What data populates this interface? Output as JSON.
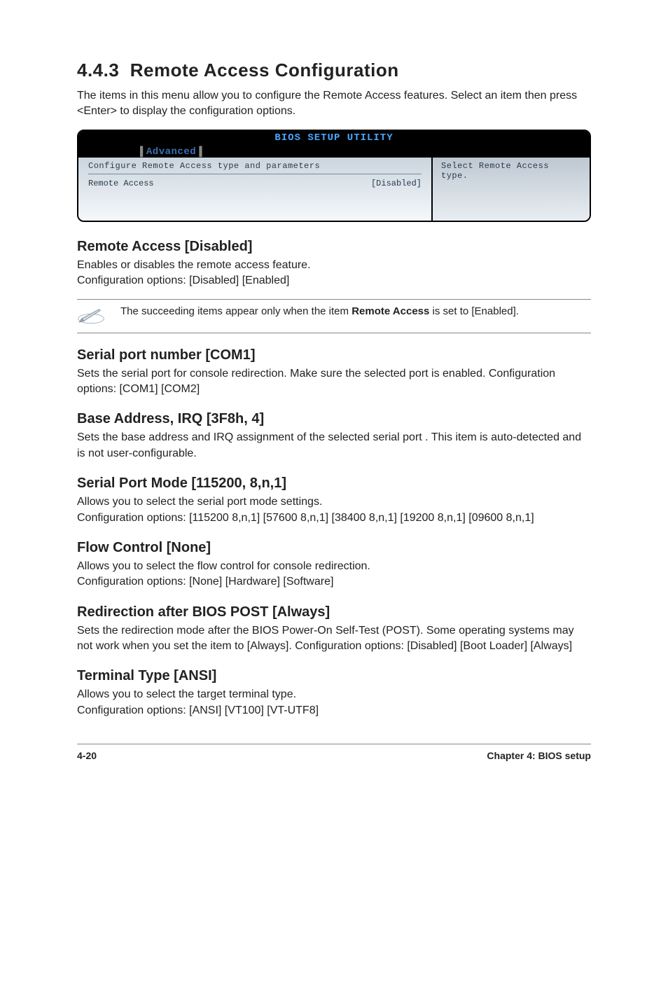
{
  "heading": {
    "number": "4.4.3",
    "title": "Remote Access Configuration"
  },
  "intro": "The items in this menu allow you to configure the Remote Access features. Select an item then press <Enter> to display the configuration options.",
  "bios": {
    "title": "BIOS SETUP UTILITY",
    "tab": "Advanced",
    "panel_title": "Configure Remote Access type and parameters",
    "option_label": "Remote Access",
    "option_value": "[Disabled]",
    "help": "Select Remote Access type."
  },
  "sections": [
    {
      "title": "Remote Access [Disabled]",
      "body": "Enables or disables the remote access feature.\nConfiguration options: [Disabled] [Enabled]"
    }
  ],
  "note": {
    "pre": "The succeeding items appear only when the item ",
    "bold": "Remote Access",
    "post": " is set to [Enabled]."
  },
  "sections2": [
    {
      "title": "Serial port number [COM1]",
      "body": "Sets the serial port for console redirection.  Make sure the selected port is enabled. Configuration options: [COM1] [COM2]"
    },
    {
      "title": "Base Address, IRQ [3F8h, 4]",
      "body": "Sets the base address and IRQ assignment of the selected serial port . This item is auto-detected and is not user-configurable."
    },
    {
      "title": "Serial Port Mode [115200, 8,n,1]",
      "body": "Allows you to select the serial port mode settings.\nConfiguration options: [115200 8,n,1] [57600 8,n,1] [38400 8,n,1] [19200 8,n,1] [09600 8,n,1]"
    },
    {
      "title": "Flow Control [None]",
      "body": "Allows you to select the flow control for console redirection.\nConfiguration options: [None] [Hardware] [Software]"
    },
    {
      "title": "Redirection after BIOS POST [Always]",
      "body": "Sets the redirection mode after the BIOS Power-On Self-Test (POST). Some operating systems may not work when you set the item to [Always]. Configuration options: [Disabled] [Boot Loader] [Always]"
    },
    {
      "title": "Terminal Type [ANSI]",
      "body": "Allows you to select the target terminal type.\nConfiguration options: [ANSI] [VT100] [VT-UTF8]"
    }
  ],
  "footer": {
    "left": "4-20",
    "right": "Chapter 4: BIOS setup"
  }
}
